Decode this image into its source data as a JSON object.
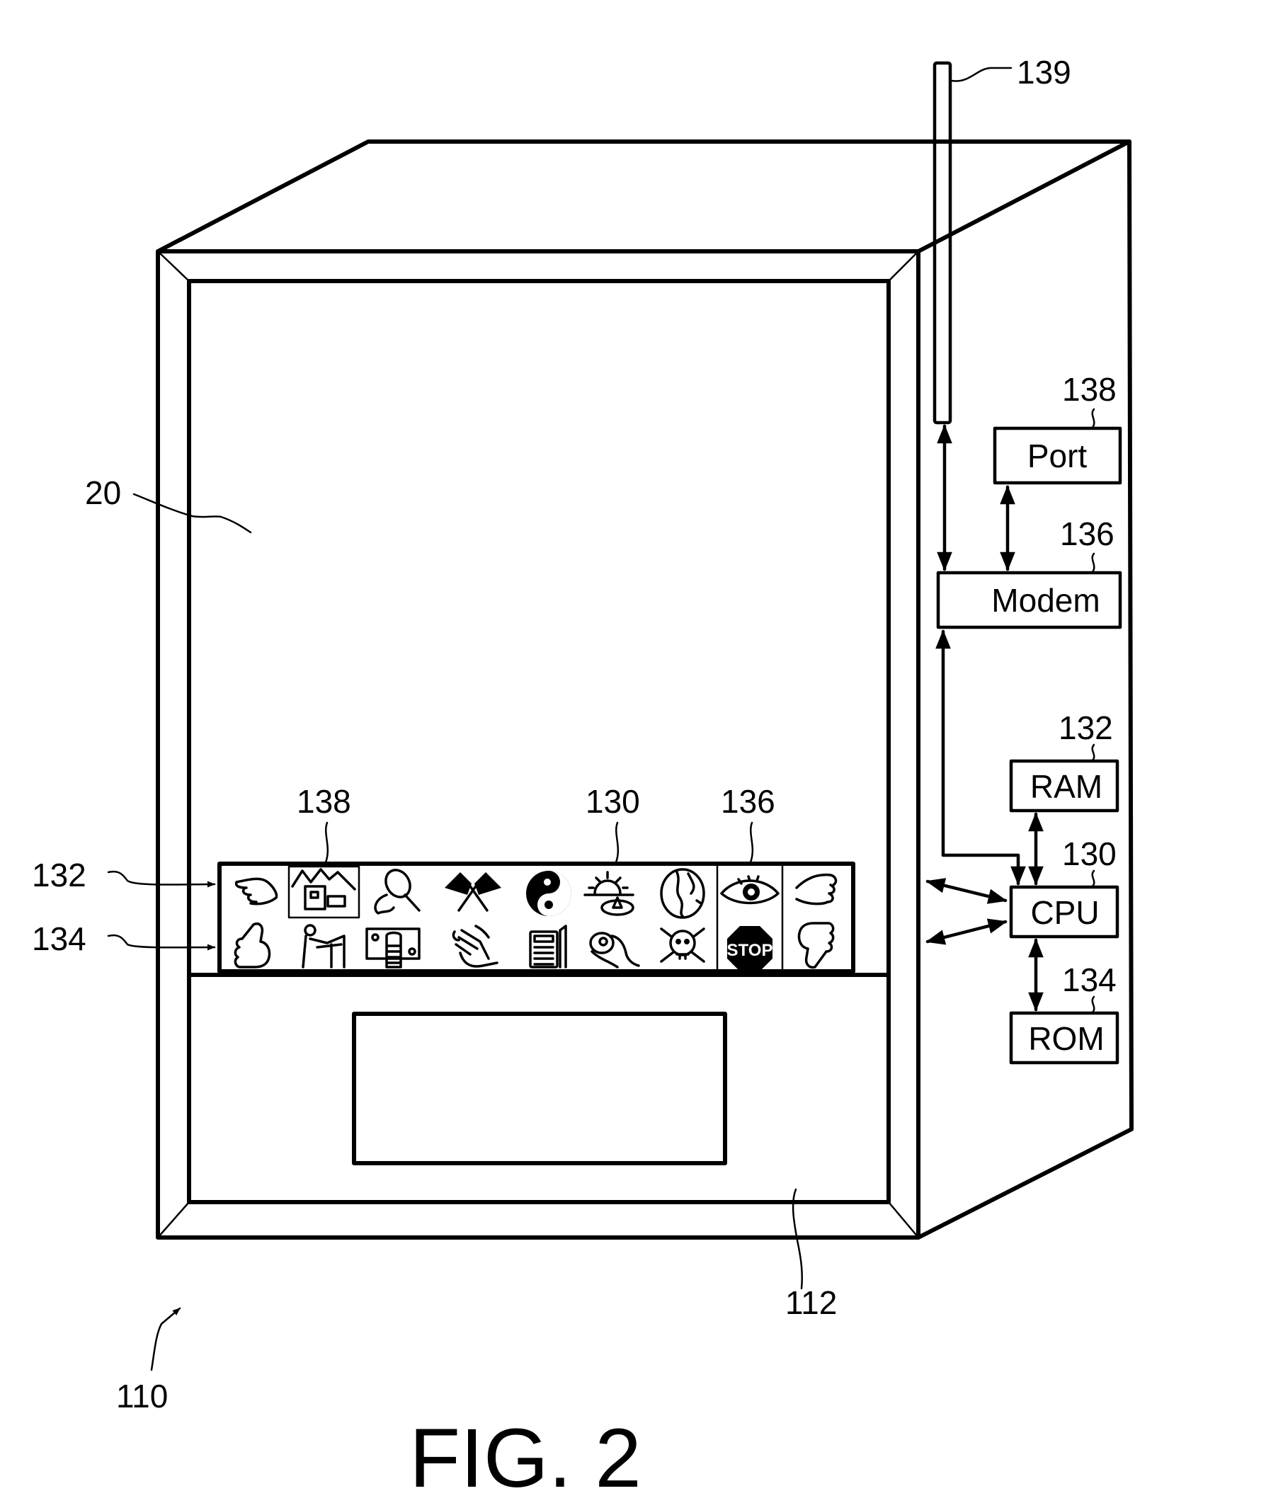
{
  "figure": {
    "caption": "FIG. 2",
    "colors": {
      "ink": "#000000",
      "paper": "#ffffff"
    }
  },
  "reference_labels": {
    "device": "110",
    "front_panel": "112",
    "display": "20",
    "antenna": "139",
    "icon_strip": "130",
    "icon_row_top": "132",
    "icon_row_bottom": "134",
    "strip_section_left": "138",
    "strip_section_right": "136"
  },
  "components": [
    {
      "id": "port",
      "label": "Port",
      "ref": "138"
    },
    {
      "id": "modem",
      "label": "Modem",
      "ref": "136"
    },
    {
      "id": "ram",
      "label": "RAM",
      "ref": "132"
    },
    {
      "id": "cpu",
      "label": "CPU",
      "ref": "130"
    },
    {
      "id": "rom",
      "label": "ROM",
      "ref": "134"
    }
  ],
  "icon_strip": {
    "row_top": [
      "pointing-hand-left",
      "house-landscape",
      "magnifier-hand",
      "checkered-flags",
      "yin-yang",
      "sunrise-alarm",
      "globe",
      "eye",
      "pointing-hand-right"
    ],
    "row_bottom": [
      "thumbs-up",
      "person-at-desk",
      "money-bill",
      "hand-holding-scroll",
      "telephone-keypad",
      "hand-ok",
      "skull-crossbones",
      "stop-sign",
      "thumbs-down"
    ],
    "stop_text": "STOP"
  },
  "connections": [
    {
      "from": "antenna",
      "to": "modem",
      "bidirectional": true
    },
    {
      "from": "port",
      "to": "modem",
      "bidirectional": true
    },
    {
      "from": "modem",
      "to": "cpu",
      "bidirectional": false
    },
    {
      "from": "ram",
      "to": "cpu",
      "bidirectional": true
    },
    {
      "from": "cpu",
      "to": "rom",
      "bidirectional": true
    },
    {
      "from": "cpu",
      "to": "icon_strip_row_top",
      "bidirectional": true
    },
    {
      "from": "cpu",
      "to": "icon_strip_row_bottom",
      "bidirectional": true
    }
  ]
}
